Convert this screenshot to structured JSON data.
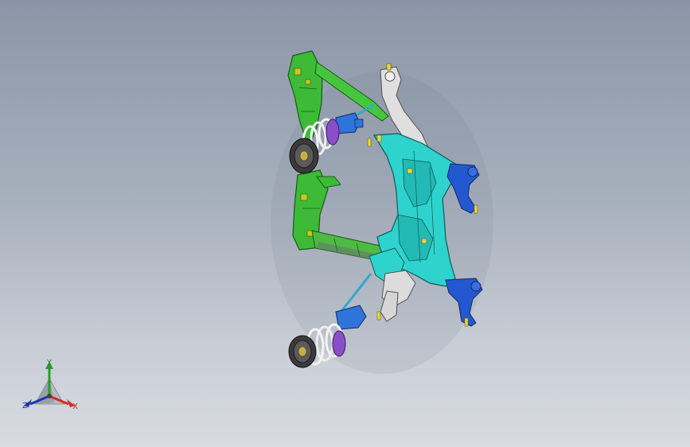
{
  "viewport": {
    "background_top": "#8a96a7",
    "background_bottom": "#d8dbe1"
  },
  "model": {
    "parts": {
      "subframe_left_color": "#3fbf3a",
      "crossmember_color": "#6a6f74",
      "cradle_color": "#2fd6d0",
      "control_arm_color": "#dcdcdc",
      "strut_color": "#2f6fd8",
      "spring_color": "#f2f2f2",
      "knuckle_color": "#2050c8",
      "bearing_color": "#8a4fc8"
    }
  },
  "triad": {
    "x_label": "X",
    "y_label": "Y",
    "z_label": "Z",
    "x_color": "#d42a20",
    "y_color": "#2a9a2a",
    "z_color": "#2033b8"
  }
}
